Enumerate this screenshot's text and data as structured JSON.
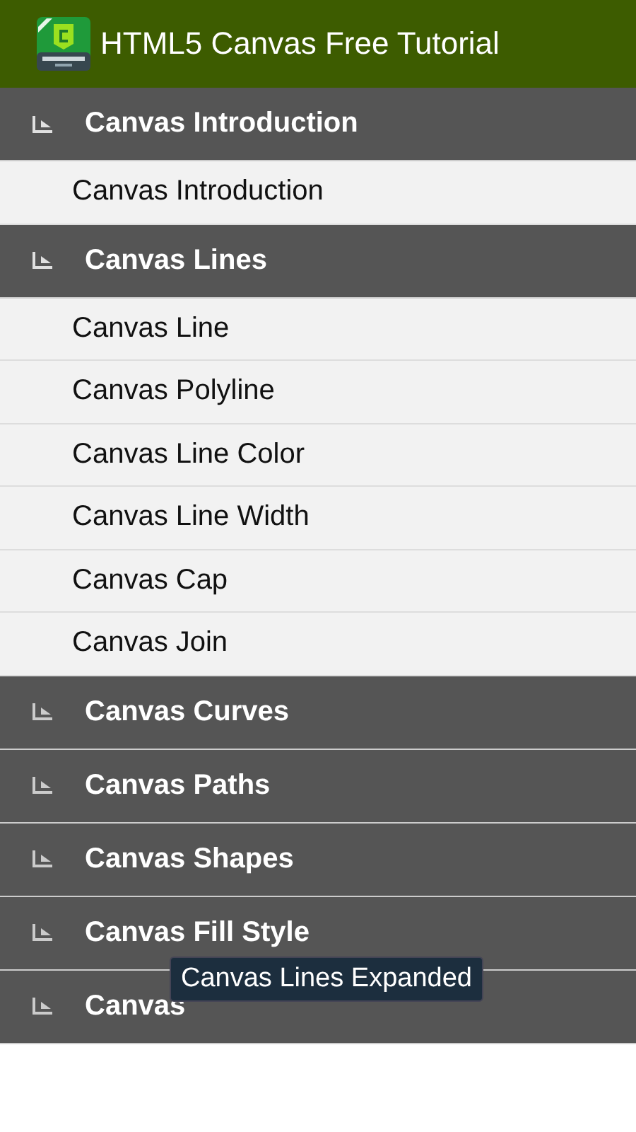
{
  "app_bar": {
    "title": "HTML5 Canvas Free Tutorial"
  },
  "groups": [
    {
      "title": "Canvas Introduction",
      "expanded": true,
      "children": [
        {
          "title": "Canvas Introduction"
        }
      ]
    },
    {
      "title": "Canvas Lines",
      "expanded": true,
      "children": [
        {
          "title": "Canvas Line"
        },
        {
          "title": "Canvas Polyline"
        },
        {
          "title": "Canvas Line Color"
        },
        {
          "title": "Canvas Line Width"
        },
        {
          "title": "Canvas Cap"
        },
        {
          "title": "Canvas Join"
        }
      ]
    },
    {
      "title": "Canvas Curves",
      "expanded": false
    },
    {
      "title": "Canvas Paths",
      "expanded": false
    },
    {
      "title": "Canvas Shapes",
      "expanded": false
    },
    {
      "title": "Canvas Fill Style",
      "expanded": false
    },
    {
      "title": "Canvas",
      "expanded": false
    }
  ],
  "toast": {
    "text": "Canvas Lines Expanded"
  }
}
